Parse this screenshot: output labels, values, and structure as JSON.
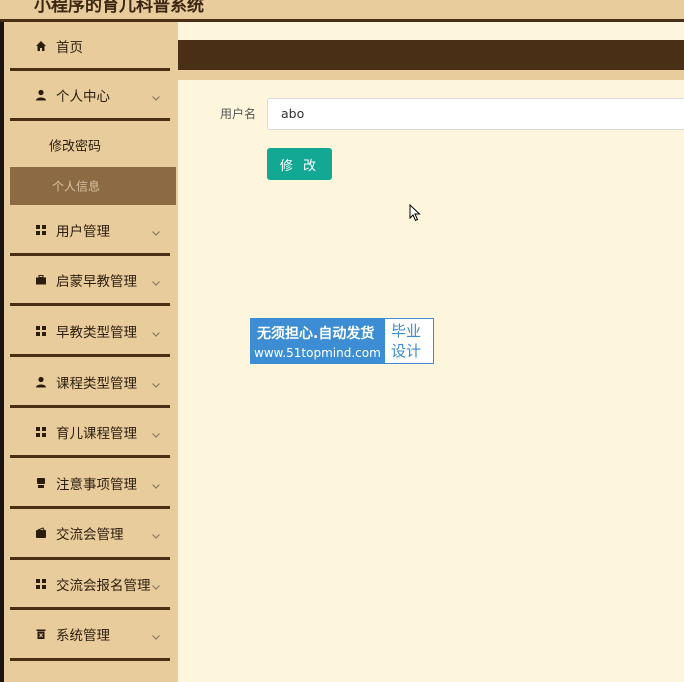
{
  "header": {
    "title": "小程序的育儿科普系统"
  },
  "sidebar": {
    "items": [
      {
        "label": "首页",
        "icon": "home-icon",
        "expandable": false
      },
      {
        "label": "个人中心",
        "icon": "user-icon",
        "expandable": true
      },
      {
        "label": "用户管理",
        "icon": "grid-icon",
        "expandable": true
      },
      {
        "label": "启蒙早教管理",
        "icon": "briefcase-icon",
        "expandable": true
      },
      {
        "label": "早教类型管理",
        "icon": "grid-icon",
        "expandable": true
      },
      {
        "label": "课程类型管理",
        "icon": "user-icon",
        "expandable": true
      },
      {
        "label": "育儿课程管理",
        "icon": "grid-icon",
        "expandable": true
      },
      {
        "label": "注意事项管理",
        "icon": "printer-icon",
        "expandable": true
      },
      {
        "label": "交流会管理",
        "icon": "wallet-icon",
        "expandable": true
      },
      {
        "label": "交流会报名管理",
        "icon": "grid-icon",
        "expandable": true
      },
      {
        "label": "系统管理",
        "icon": "trash-icon",
        "expandable": true
      }
    ],
    "submenu": [
      {
        "label": "修改密码",
        "active": false
      },
      {
        "label": "个人信息",
        "active": true
      }
    ]
  },
  "form": {
    "username_label": "用户名",
    "username_value": "abo",
    "submit_label": "修 改"
  },
  "watermark": {
    "line1": "无须担心.自动发货",
    "line2": "www.51topmind.com",
    "right": "毕业设计"
  },
  "colors": {
    "sidebar_bg": "#e9cc9c",
    "dark_brown": "#4a2f17",
    "active_item": "#8b6a44",
    "main_bg": "#fdf6dc",
    "button": "#13a894",
    "watermark_blue": "#3c8dd4"
  }
}
